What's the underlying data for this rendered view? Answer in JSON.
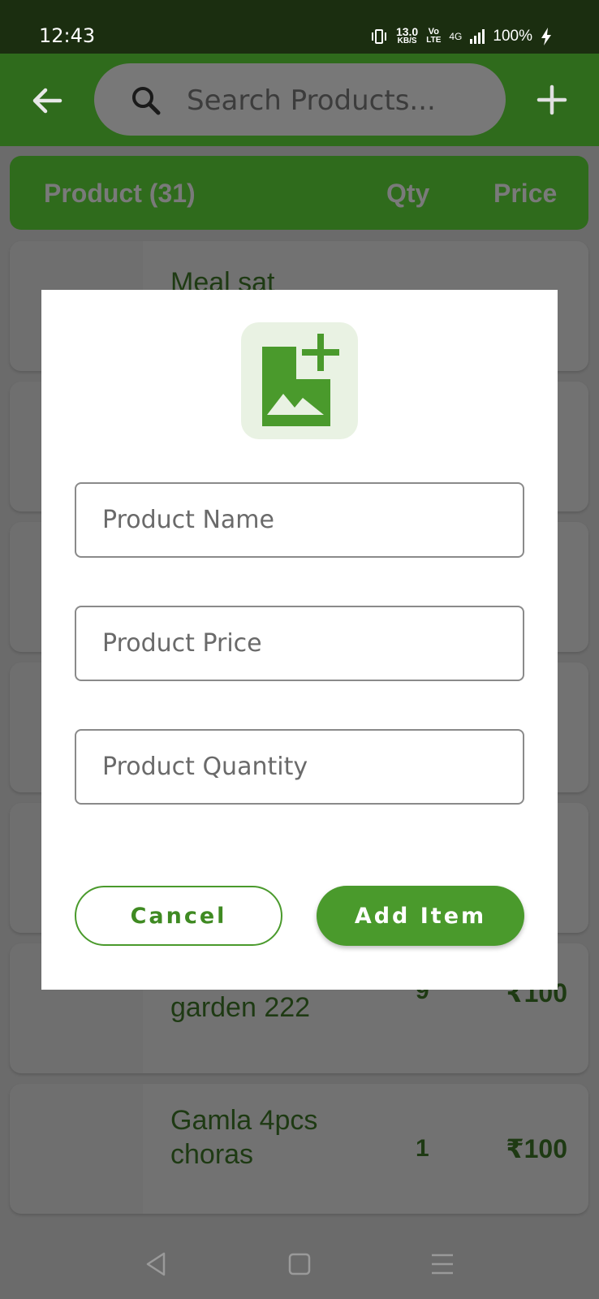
{
  "status_bar": {
    "time": "12:43",
    "net_speed_value": "13.0",
    "net_speed_unit": "KB/S",
    "volte_top": "Vo",
    "volte_bottom": "LTE",
    "network": "4G",
    "battery": "100%"
  },
  "app_bar": {
    "search_placeholder": "Search Products..."
  },
  "list_header": {
    "product_label": "Product (31)",
    "qty_label": "Qty",
    "price_label": "Price"
  },
  "products": [
    {
      "name": "Meal sat",
      "qty": "",
      "price": ""
    },
    {
      "name": "",
      "qty": "",
      "price": ""
    },
    {
      "name": "",
      "qty": "",
      "price": ""
    },
    {
      "name": "",
      "qty": "",
      "price": ""
    },
    {
      "name": "",
      "qty": "",
      "price": ""
    },
    {
      "name": "garden 222",
      "qty": "9",
      "price": "₹100"
    },
    {
      "name": "Gamla 4pcs choras",
      "qty": "1",
      "price": "₹100"
    }
  ],
  "dialog": {
    "image_picker_icon": "add-photo-icon",
    "name_placeholder": "Product Name",
    "price_placeholder": "Product Price",
    "quantity_placeholder": "Product Quantity",
    "cancel_label": "Cancel",
    "add_label": "Add Item"
  },
  "colors": {
    "primary": "#4a9a2c",
    "app_bar": "#2f6b1c",
    "status_bar": "#1b2e10"
  }
}
